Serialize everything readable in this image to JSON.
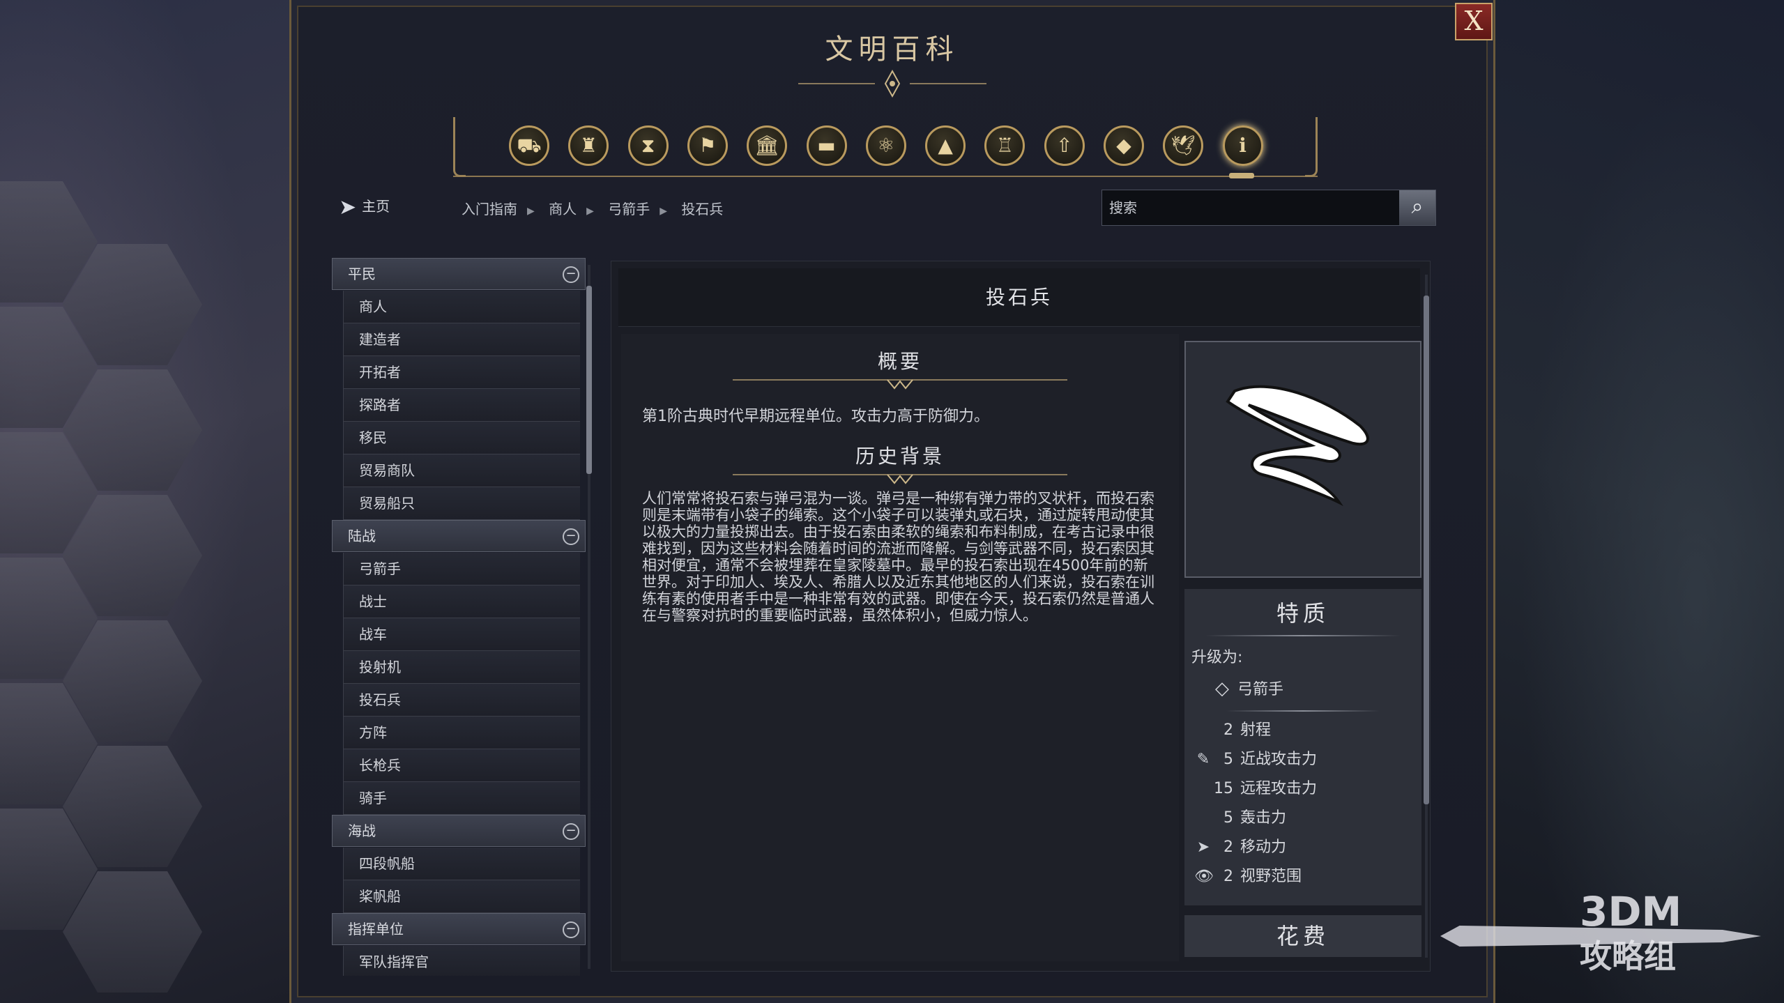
{
  "window": {
    "title": "文明百科",
    "close_label": "X"
  },
  "icon_bar": {
    "icons": [
      {
        "name": "units-icon",
        "glyph": "⛟"
      },
      {
        "name": "improvements-icon",
        "glyph": "♜"
      },
      {
        "name": "eras-icon",
        "glyph": "⧗"
      },
      {
        "name": "civilizations-icon",
        "glyph": "⚑"
      },
      {
        "name": "buildings-icon",
        "glyph": "🏛"
      },
      {
        "name": "resources-icon",
        "glyph": "▬"
      },
      {
        "name": "technology-icon",
        "glyph": "⚛"
      },
      {
        "name": "terrain-icon",
        "glyph": "▲"
      },
      {
        "name": "wonders-icon",
        "glyph": "♖"
      },
      {
        "name": "upgrades-icon",
        "glyph": "⇧"
      },
      {
        "name": "concepts-icon",
        "glyph": "◆"
      },
      {
        "name": "religion-icon",
        "glyph": "🕊"
      },
      {
        "name": "info-icon",
        "glyph": "ℹ"
      }
    ]
  },
  "nav": {
    "home_label": "主页",
    "breadcrumbs": [
      "入门指南",
      "商人",
      "弓箭手",
      "投石兵"
    ]
  },
  "search": {
    "placeholder": "搜索"
  },
  "sidebar": {
    "categories": [
      {
        "label": "平民",
        "items": [
          "商人",
          "建造者",
          "开拓者",
          "探路者",
          "移民",
          "贸易商队",
          "贸易船只"
        ]
      },
      {
        "label": "陆战",
        "items": [
          "弓箭手",
          "战士",
          "战车",
          "投射机",
          "投石兵",
          "方阵",
          "长枪兵",
          "骑手"
        ]
      },
      {
        "label": "海战",
        "items": [
          "四段帆船",
          "桨帆船"
        ]
      },
      {
        "label": "指挥单位",
        "items": [
          "军队指挥官"
        ]
      }
    ]
  },
  "article": {
    "title": "投石兵",
    "summary_title": "概要",
    "summary_text": "第1阶古典时代早期远程单位。攻击力高于防御力。",
    "history_title": "历史背景",
    "history_text": "人们常常将投石索与弹弓混为一谈。弹弓是一种绑有弹力带的叉状杆，而投石索则是末端带有小袋子的绳索。这个小袋子可以装弹丸或石块，通过旋转甩动使其以极大的力量投掷出去。由于投石索由柔软的绳索和布料制成，在考古记录中很难找到，因为这些材料会随着时间的流逝而降解。与剑等武器不同，投石索因其相对便宜，通常不会被埋葬在皇家陵墓中。最早的投石索出现在4500年前的新世界。对于印加人、埃及人、希腊人以及近东其他地区的人们来说，投石索在训练有素的使用者手中是一种非常有效的武器。即使在今天，投石索仍然是普通人在与警察对抗时的重要临时武器，虽然体积小，但威力惊人。"
  },
  "traits": {
    "title": "特质",
    "upgrade_label": "升级为:",
    "upgrade_unit": "弓箭手",
    "stats": [
      {
        "icon": "",
        "value": "2",
        "label": "射程"
      },
      {
        "icon": "✎",
        "value": "5",
        "label": "近战攻击力"
      },
      {
        "icon": "",
        "value": "15",
        "label": "远程攻击力"
      },
      {
        "icon": "",
        "value": "5",
        "label": "轰击力"
      },
      {
        "icon": "➤",
        "value": "2",
        "label": "移动力"
      },
      {
        "icon": "👁",
        "value": "2",
        "label": "视野范围"
      }
    ],
    "cost_title": "花费"
  },
  "watermark": {
    "line1": "3DM",
    "line2": "攻略组"
  }
}
